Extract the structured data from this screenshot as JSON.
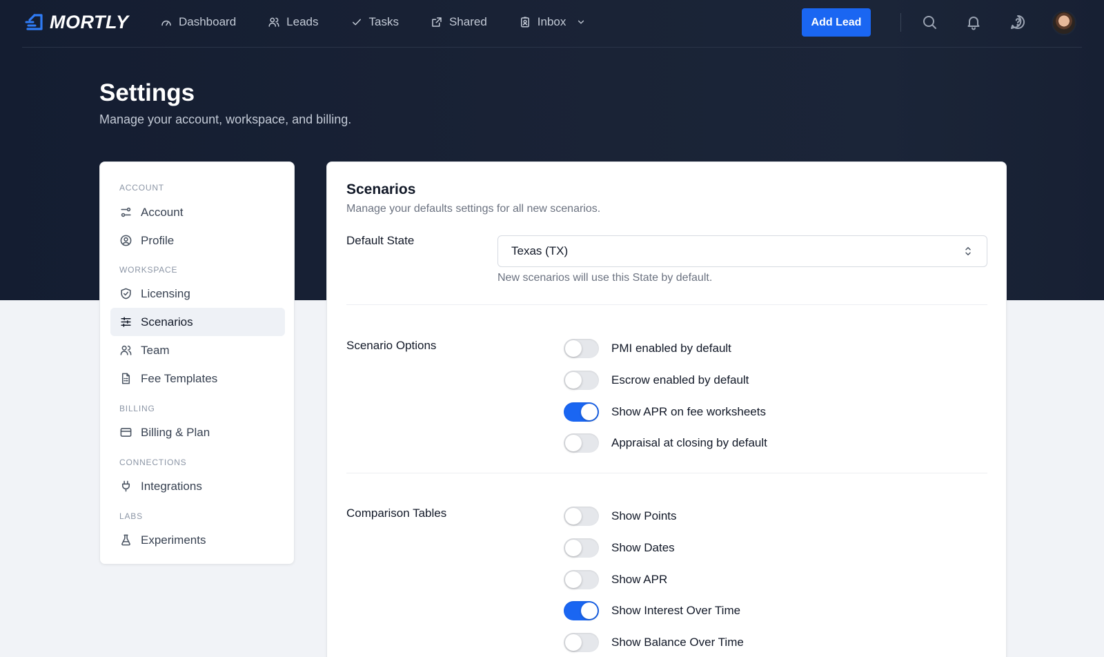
{
  "app": {
    "name": "MORTLY"
  },
  "nav": {
    "items": [
      {
        "label": "Dashboard",
        "icon": "gauge-icon"
      },
      {
        "label": "Leads",
        "icon": "users-icon"
      },
      {
        "label": "Tasks",
        "icon": "check-icon"
      },
      {
        "label": "Shared",
        "icon": "external-link-icon"
      },
      {
        "label": "Inbox",
        "icon": "inbox-badge-icon"
      }
    ],
    "add_lead_label": "Add Lead",
    "icons": [
      "search-icon",
      "bell-icon",
      "help-circle-icon"
    ]
  },
  "header": {
    "title": "Settings",
    "subtitle": "Manage your account, workspace, and billing."
  },
  "sidebar": {
    "sections": [
      {
        "label": "ACCOUNT",
        "items": [
          {
            "label": "Account",
            "icon": "sliders-icon"
          },
          {
            "label": "Profile",
            "icon": "user-circle-icon"
          }
        ]
      },
      {
        "label": "WORKSPACE",
        "items": [
          {
            "label": "Licensing",
            "icon": "shield-check-icon"
          },
          {
            "label": "Scenarios",
            "icon": "adjustments-icon",
            "active": true
          },
          {
            "label": "Team",
            "icon": "users-icon"
          },
          {
            "label": "Fee Templates",
            "icon": "document-icon"
          }
        ]
      },
      {
        "label": "BILLING",
        "items": [
          {
            "label": "Billing & Plan",
            "icon": "credit-card-icon"
          }
        ]
      },
      {
        "label": "CONNECTIONS",
        "items": [
          {
            "label": "Integrations",
            "icon": "plug-icon"
          }
        ]
      },
      {
        "label": "LABS",
        "items": [
          {
            "label": "Experiments",
            "icon": "flask-icon"
          }
        ]
      }
    ]
  },
  "main": {
    "title": "Scenarios",
    "description": "Manage your defaults settings for all new scenarios.",
    "default_state": {
      "label": "Default State",
      "value": "Texas (TX)",
      "hint": "New scenarios will use this State by default."
    },
    "scenario_options": {
      "label": "Scenario Options",
      "toggles": [
        {
          "label": "PMI enabled by default",
          "on": false
        },
        {
          "label": "Escrow enabled by default",
          "on": false
        },
        {
          "label": "Show APR on fee worksheets",
          "on": true
        },
        {
          "label": "Appraisal at closing by default",
          "on": false
        }
      ]
    },
    "comparison_tables": {
      "label": "Comparison Tables",
      "toggles": [
        {
          "label": "Show Points",
          "on": false
        },
        {
          "label": "Show Dates",
          "on": false
        },
        {
          "label": "Show APR",
          "on": false
        },
        {
          "label": "Show Interest Over Time",
          "on": true
        },
        {
          "label": "Show Balance Over Time",
          "on": false
        }
      ]
    }
  },
  "colors": {
    "accent": "#1a66f2",
    "hero_bg": "#161f33",
    "page_bg": "#f1f3f7"
  }
}
